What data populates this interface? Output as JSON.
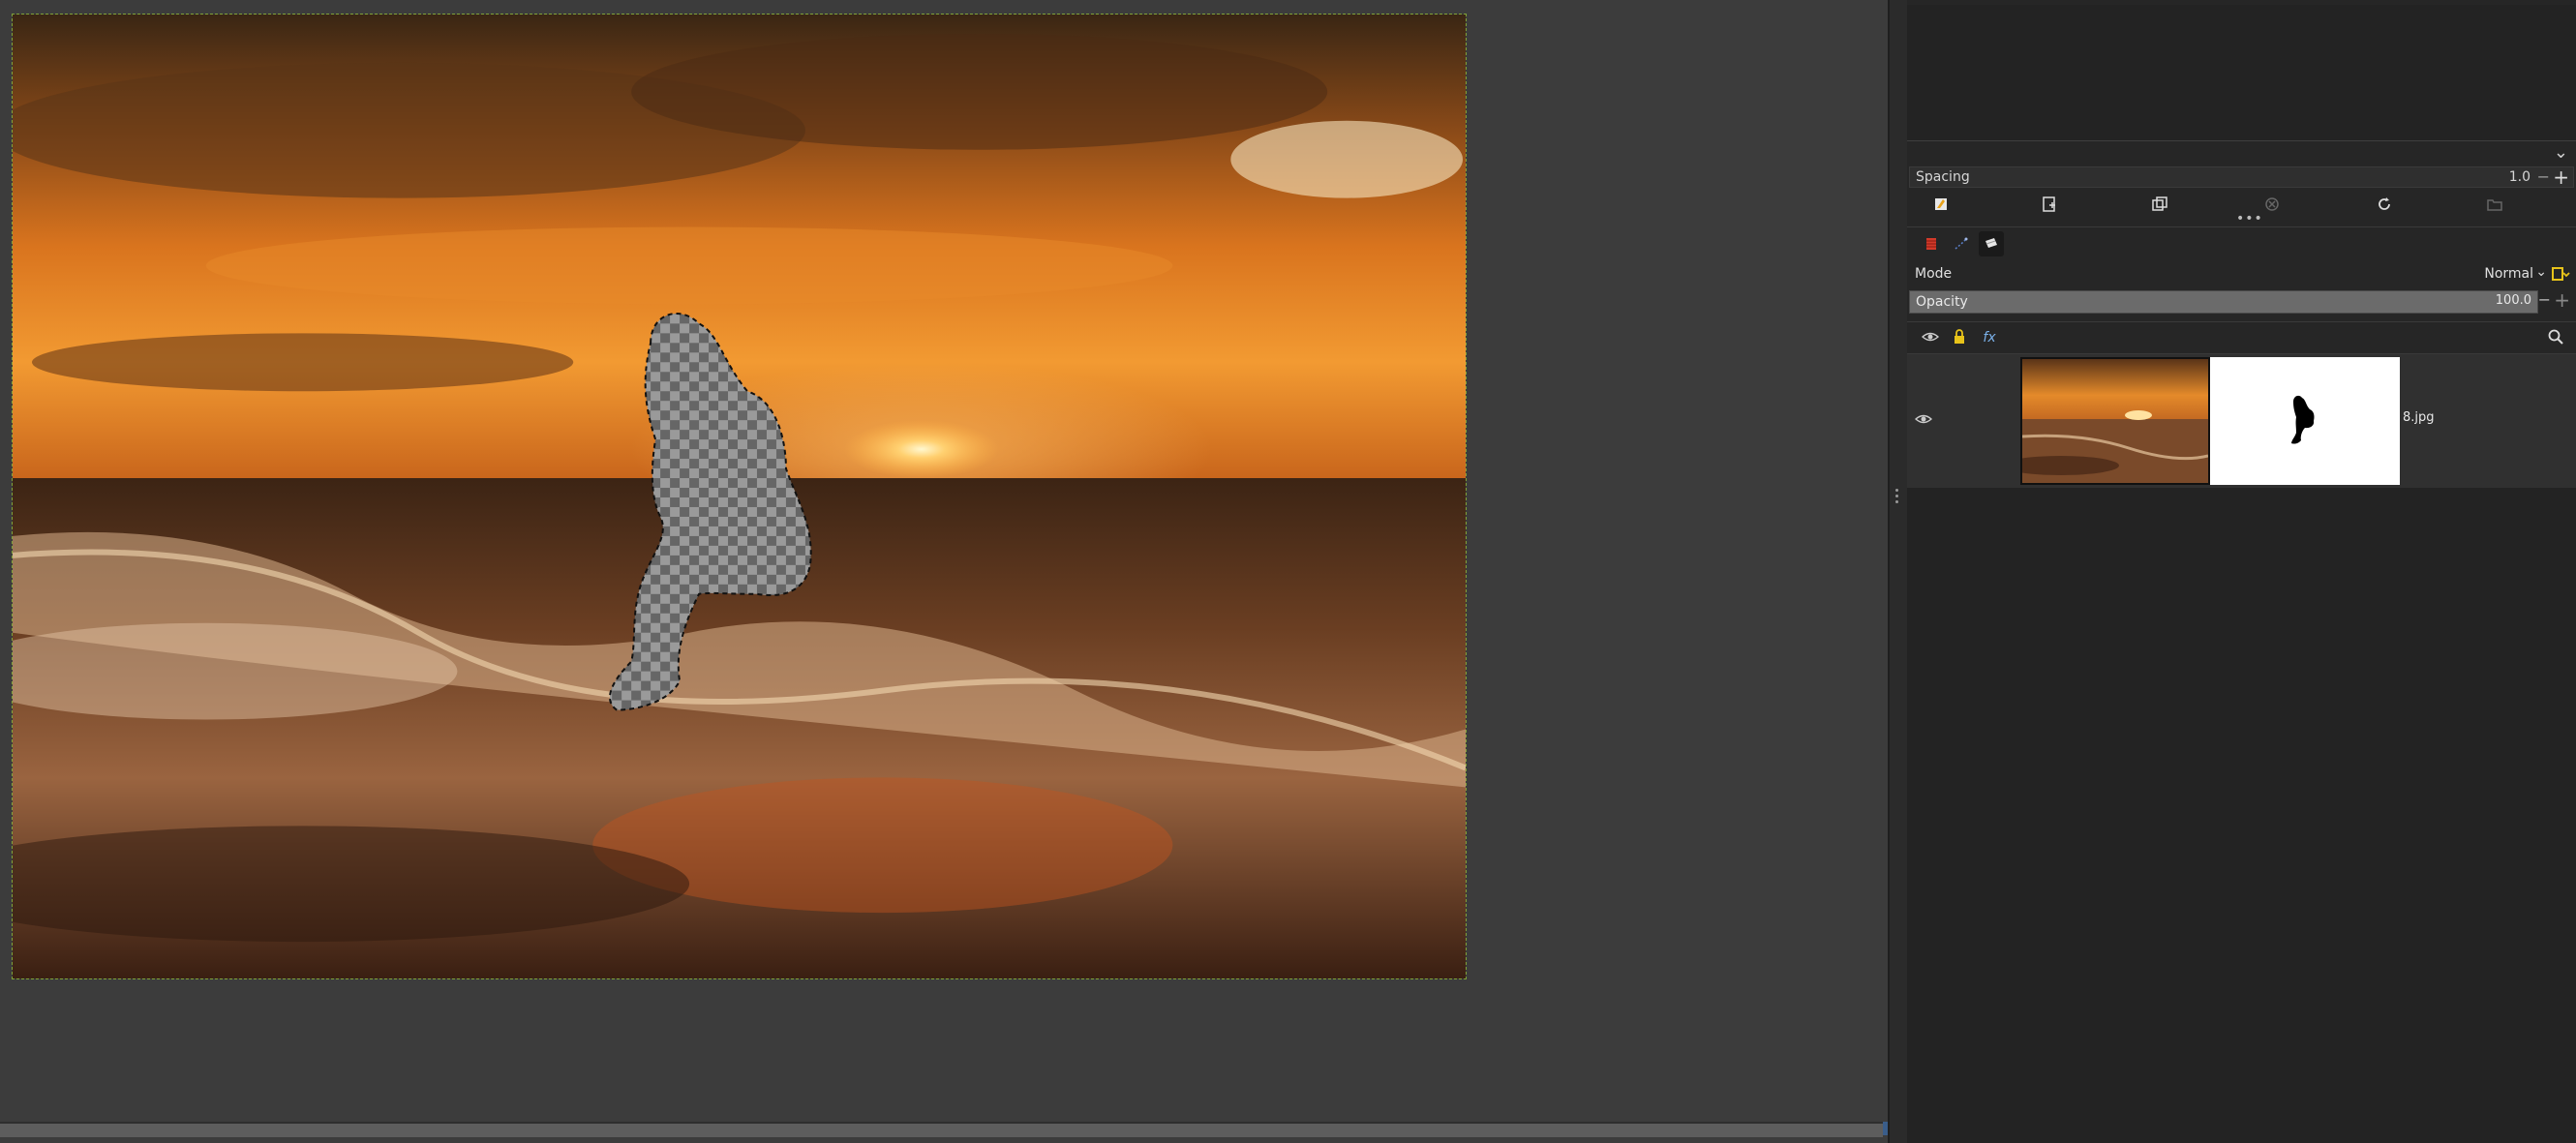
{
  "canvas": {
    "image_description_icon": "sunset-beach-image",
    "selection_icon": "transparent-selection-cutout"
  },
  "brushes": {
    "spacing_label": "Spacing",
    "spacing_value": "1.0",
    "minus": "−",
    "plus": "+",
    "expander_icon": "chevron-down-icon"
  },
  "toolbar": {
    "icons": [
      "edit-brush-icon",
      "new-brush-icon",
      "duplicate-brush-icon",
      "delete-brush-icon",
      "refresh-icon",
      "open-folder-icon"
    ],
    "more": "•••"
  },
  "tabs": {
    "items": [
      "brushes-tab-icon",
      "paths-tab-icon",
      "layers-tab-icon"
    ]
  },
  "layers": {
    "mode_label": "Mode",
    "mode_value": "Normal",
    "opacity_label": "Opacity",
    "opacity_value": "100.0",
    "opacity_level": 1.0,
    "tool_icons": [
      "visibility-icon",
      "lock-icon",
      "effects-icon",
      "search-icon"
    ],
    "fx": "fx",
    "items": [
      {
        "name": "8.jpg",
        "visible": true,
        "has_mask": true
      }
    ]
  },
  "colors": {
    "canvas_bg": "#3c3c3c",
    "dock_bg": "#262626",
    "selection_border": "#7fa33a",
    "accent_yellow": "#e8c31a"
  }
}
